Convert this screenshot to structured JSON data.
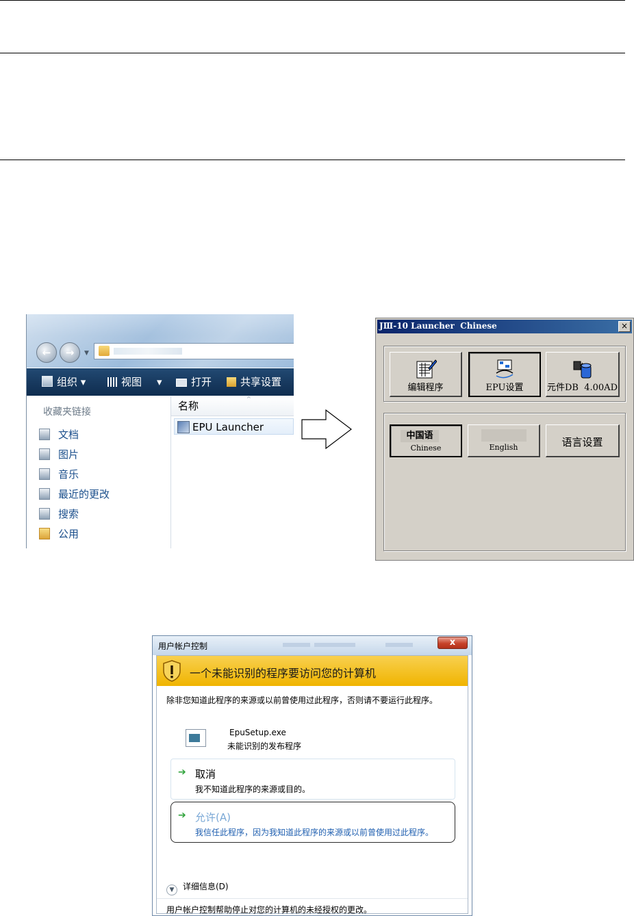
{
  "explorer": {
    "toolbar": {
      "organize": "组织 ▾",
      "views": "视图",
      "views_arrow": "▾",
      "open": "打开",
      "share": "共享设置"
    },
    "sidebar": {
      "heading": "收藏夹链接",
      "items": [
        {
          "label": "文档",
          "icon": "documents-icon"
        },
        {
          "label": "图片",
          "icon": "pictures-icon"
        },
        {
          "label": "音乐",
          "icon": "music-icon"
        },
        {
          "label": "最近的更改",
          "icon": "recent-changes-icon"
        },
        {
          "label": "搜索",
          "icon": "search-folder-icon"
        },
        {
          "label": "公用",
          "icon": "public-folder-icon"
        }
      ]
    },
    "column_header": "名称",
    "file": "EPU Launcher"
  },
  "launcher": {
    "title": "JⅢ-10 Launcher  Chinese",
    "close": "×",
    "buttons": {
      "edit_program": "编辑程序",
      "epu_setup": "EPU设置",
      "parts_db": "元件DB  4.00AD"
    },
    "language": {
      "chinese_cn": "中国语",
      "chinese_en": "Chinese",
      "english": "English",
      "settings": "语言设置"
    }
  },
  "uac": {
    "window_title": "用户帐户控制",
    "close": "x",
    "banner": "一个未能识别的程序要访问您的计算机",
    "description": "除非您知道此程序的来源或以前曾使用过此程序，否则请不要运行此程序。",
    "program": "EpuSetup.exe",
    "publisher": "未能识别的发布程序",
    "cancel_title": "取消",
    "cancel_desc": "我不知道此程序的来源或目的。",
    "allow_title": "允许(A)",
    "allow_desc": "我信任此程序，因为我知道此程序的来源或以前曾使用过此程序。",
    "details": "详细信息(D)",
    "footer": "用户帐户控制帮助停止对您的计算机的未经授权的更改。"
  },
  "colors": {
    "vista_toolbar": "#183a60",
    "win98_face": "#d4d0c8",
    "uac_banner": "#f0b400",
    "link_blue": "#1f5fb0"
  }
}
